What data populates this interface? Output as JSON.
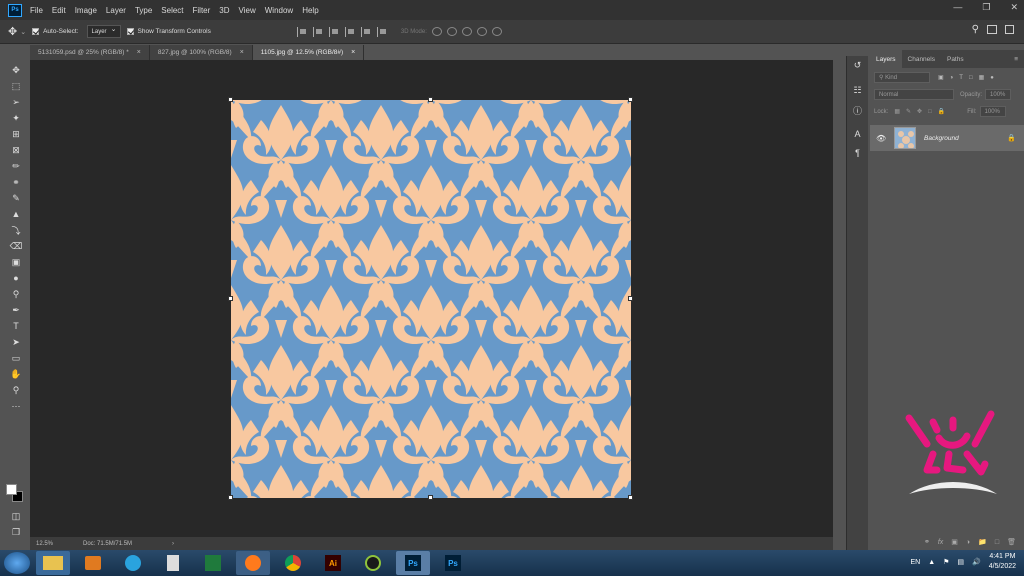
{
  "menu": [
    "File",
    "Edit",
    "Image",
    "Layer",
    "Type",
    "Select",
    "Filter",
    "3D",
    "View",
    "Window",
    "Help"
  ],
  "options": {
    "auto_select_label": "Auto-Select:",
    "auto_select_value": "Layer",
    "transform_label": "Show Transform Controls",
    "mode_3d_label": "3D Mode:"
  },
  "tabs": [
    {
      "label": "5131059.psd @ 25% (RGB/8) *",
      "close": "×"
    },
    {
      "label": "827.jpg @ 100% (RGB/8)",
      "close": "×"
    },
    {
      "label": "1105.jpg @ 12.5% (RGB/8#)",
      "close": "×"
    }
  ],
  "status": {
    "zoom": "12.5%",
    "doc": "Doc: 71.5M/71.5M",
    "arrow": "›"
  },
  "panel": {
    "tabs": [
      "Layers",
      "Channels",
      "Paths"
    ],
    "kind_placeholder": "Kind",
    "blend_mode": "Normal",
    "opacity_label": "Opacity:",
    "opacity_value": "100%",
    "lock_label": "Lock:",
    "fill_label": "Fill:",
    "fill_value": "100%",
    "layer_name": "Background"
  },
  "taskbar": {
    "apps": [
      "Ai",
      "Ps",
      "Ps"
    ],
    "lang": "EN",
    "time": "4:41 PM",
    "date": "4/5/2022"
  },
  "colors": {
    "pattern_bg": "#6799c9",
    "pattern_fg": "#f8c8a0",
    "mascot": "#e6187f"
  }
}
